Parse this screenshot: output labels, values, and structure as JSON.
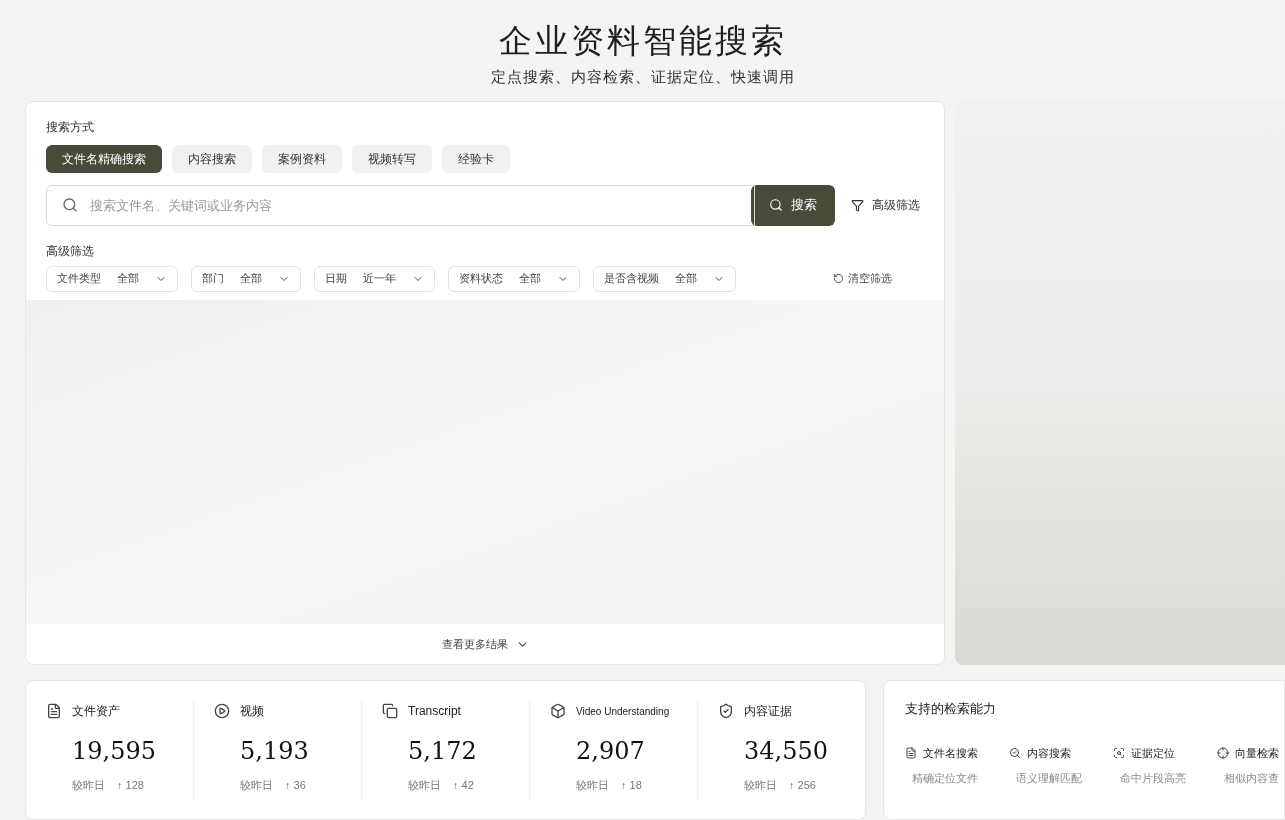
{
  "header": {
    "title": "企业资料智能搜索",
    "subtitle": "定点搜索、内容检索、证据定位、快速调用"
  },
  "search_modes": {
    "label": "搜索方式",
    "tabs": [
      {
        "label": "文件名精确搜索",
        "selected": true
      },
      {
        "label": "内容搜索",
        "selected": false
      },
      {
        "label": "案例资料",
        "selected": false
      },
      {
        "label": "视频转写",
        "selected": false
      },
      {
        "label": "经验卡",
        "selected": false
      }
    ]
  },
  "search": {
    "placeholder": "搜索文件名、关键词或业务内容",
    "button": "搜索",
    "advanced_link": "高级筛选"
  },
  "filters": {
    "label": "高级筛选",
    "items": [
      {
        "name": "文件类型",
        "value": "全部"
      },
      {
        "name": "部门",
        "value": "全部"
      },
      {
        "name": "日期",
        "value": "近一年"
      },
      {
        "name": "资料状态",
        "value": "全部"
      },
      {
        "name": "是否含视频",
        "value": "全部"
      }
    ],
    "clear": "清空筛选"
  },
  "more_results": "查看更多结果",
  "stats": [
    {
      "kind": "file",
      "label": "文件资产",
      "value": "19,595",
      "compare": "较昨日",
      "delta": "↑ 128"
    },
    {
      "kind": "video",
      "label": "视频",
      "value": "5,193",
      "compare": "较昨日",
      "delta": "↑ 36"
    },
    {
      "kind": "transcript",
      "label": "Transcript",
      "value": "5,172",
      "compare": "较昨日",
      "delta": "↑ 42"
    },
    {
      "kind": "cube",
      "label": "Video Understanding",
      "value": "2,907",
      "compare": "较昨日",
      "delta": "↑ 18"
    },
    {
      "kind": "shield",
      "label": "内容证据",
      "value": "34,550",
      "compare": "较昨日",
      "delta": "↑ 256"
    }
  ],
  "capabilities": {
    "title": "支持的检索能力",
    "items": [
      {
        "kind": "file",
        "name": "文件名搜索",
        "desc": "精确定位文件"
      },
      {
        "kind": "search",
        "name": "内容搜索",
        "desc": "语义理解匹配"
      },
      {
        "kind": "target",
        "name": "证据定位",
        "desc": "命中片段高亮"
      },
      {
        "kind": "vector",
        "name": "向量检索",
        "desc": "相似内容查"
      }
    ]
  }
}
